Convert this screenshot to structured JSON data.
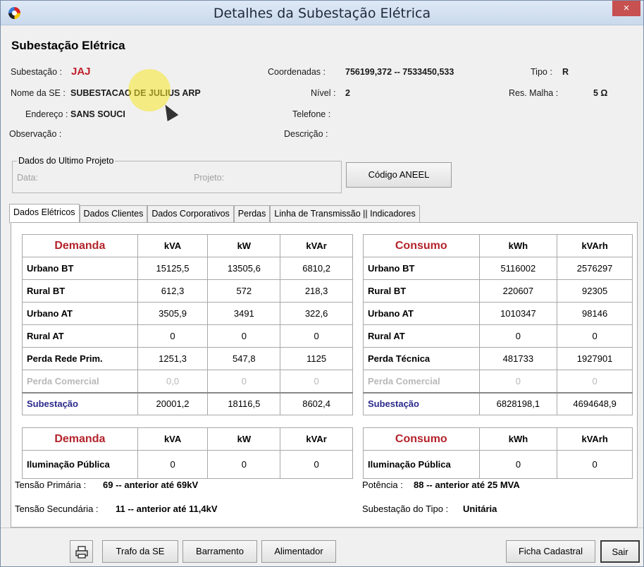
{
  "window": {
    "title": "Detalhes da Subestação Elétrica",
    "close_glyph": "×",
    "icon": "app-logo-icon"
  },
  "header": {
    "title": "Subestação Elétrica",
    "subestacao_label": "Subestação :",
    "subestacao_value": "JAJ",
    "nome_label": "Nome da SE :",
    "nome_value": "SUBESTACAO DE JULIUS ARP",
    "endereco_label": "Endereço :",
    "endereco_value": "SANS SOUCI",
    "observacao_label": "Observação :",
    "coordenadas_label": "Coordenadas :",
    "coordenadas_value": "756199,372 -- 7533450,533",
    "nivel_label": "Nível :",
    "nivel_value": "2",
    "telefone_label": "Telefone :",
    "descricao_label": "Descrição :",
    "tipo_label": "Tipo :",
    "tipo_value": "R",
    "res_malha_label": "Res. Malha :",
    "res_malha_value": "5 Ω"
  },
  "ultimo_projeto": {
    "legend": "Dados do Ultimo Projeto",
    "data_label": "Data:",
    "projeto_label": "Projeto:"
  },
  "aneel_button": "Código ANEEL",
  "tabs": [
    {
      "label": "Dados Elétricos"
    },
    {
      "label": "Dados Clientes"
    },
    {
      "label": "Dados Corporativos"
    },
    {
      "label": "Perdas"
    },
    {
      "label": "Linha de Transmissão || Indicadores"
    }
  ],
  "demanda_table": {
    "headers": [
      "Demanda",
      "kVA",
      "kW",
      "kVAr"
    ],
    "rows": [
      [
        "Urbano BT",
        "15125,5",
        "13505,6",
        "6810,2"
      ],
      [
        "Rural BT",
        "612,3",
        "572",
        "218,3"
      ],
      [
        "Urbano AT",
        "3505,9",
        "3491",
        "322,6"
      ],
      [
        "Rural AT",
        "0",
        "0",
        "0"
      ],
      [
        "Perda Rede Prim.",
        "1251,3",
        "547,8",
        "1125"
      ],
      [
        "Perda Comercial",
        "0,0",
        "0",
        "0"
      ],
      [
        "Subestação",
        "20001,2",
        "18116,5",
        "8602,4"
      ]
    ]
  },
  "consumo_table": {
    "headers": [
      "Consumo",
      "kWh",
      "kVArh"
    ],
    "rows": [
      [
        "Urbano BT",
        "5116002",
        "2576297"
      ],
      [
        "Rural BT",
        "220607",
        "92305"
      ],
      [
        "Urbano AT",
        "1010347",
        "98146"
      ],
      [
        "Rural AT",
        "0",
        "0"
      ],
      [
        "Perda Técnica",
        "481733",
        "1927901"
      ],
      [
        "Perda Comercial",
        "0",
        "0"
      ],
      [
        "Subestação",
        "6828198,1",
        "4694648,9"
      ]
    ]
  },
  "demanda_ip_table": {
    "headers": [
      "Demanda",
      "kVA",
      "kW",
      "kVAr"
    ],
    "rows": [
      [
        "Iluminação Pública",
        "0",
        "0",
        "0"
      ]
    ]
  },
  "consumo_ip_table": {
    "headers": [
      "Consumo",
      "kWh",
      "kVArh"
    ],
    "rows": [
      [
        "Iluminação Pública",
        "0",
        "0"
      ]
    ]
  },
  "footer_info": {
    "tensao_primaria_label": "Tensão Primária :",
    "tensao_primaria_value": "69 -- anterior até 69kV",
    "tensao_secundaria_label": "Tensão Secundária :",
    "tensao_secundaria_value": "11 -- anterior até 11,4kV",
    "potencia_label": "Potência :",
    "potencia_value": "88 -- anterior até 25 MVA",
    "tipo_sub_label": "Subestação do Tipo :",
    "tipo_sub_value": "Unitária"
  },
  "bottom_buttons": {
    "print_icon": "printer-icon",
    "trafo": "Trafo da SE",
    "barramento": "Barramento",
    "alimentador": "Alimentador",
    "ficha": "Ficha Cadastral",
    "sair": "Sair"
  }
}
